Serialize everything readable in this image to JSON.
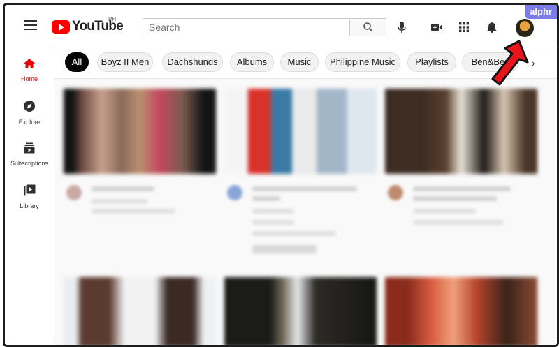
{
  "header": {
    "logo_text": "YouTube",
    "logo_region": "PH",
    "search_placeholder": "Search",
    "watermark": "alphr"
  },
  "chips": [
    {
      "label": "All",
      "active": true
    },
    {
      "label": "Boyz II Men",
      "active": false
    },
    {
      "label": "Dachshunds",
      "active": false
    },
    {
      "label": "Albums",
      "active": false
    },
    {
      "label": "Music",
      "active": false
    },
    {
      "label": "Philippine Music",
      "active": false
    },
    {
      "label": "Playlists",
      "active": false
    },
    {
      "label": "Ben&Ben",
      "active": false
    }
  ],
  "sidebar": {
    "items": [
      {
        "label": "Home",
        "icon": "home-icon"
      },
      {
        "label": "Explore",
        "icon": "compass-icon"
      },
      {
        "label": "Subscriptions",
        "icon": "subscriptions-icon"
      },
      {
        "label": "Library",
        "icon": "library-icon"
      }
    ]
  },
  "colors": {
    "brand_red": "#ff0000",
    "active_chip": "#030303",
    "annotation_arrow": "#e8151b",
    "watermark_bg": "#7b7ce6"
  }
}
